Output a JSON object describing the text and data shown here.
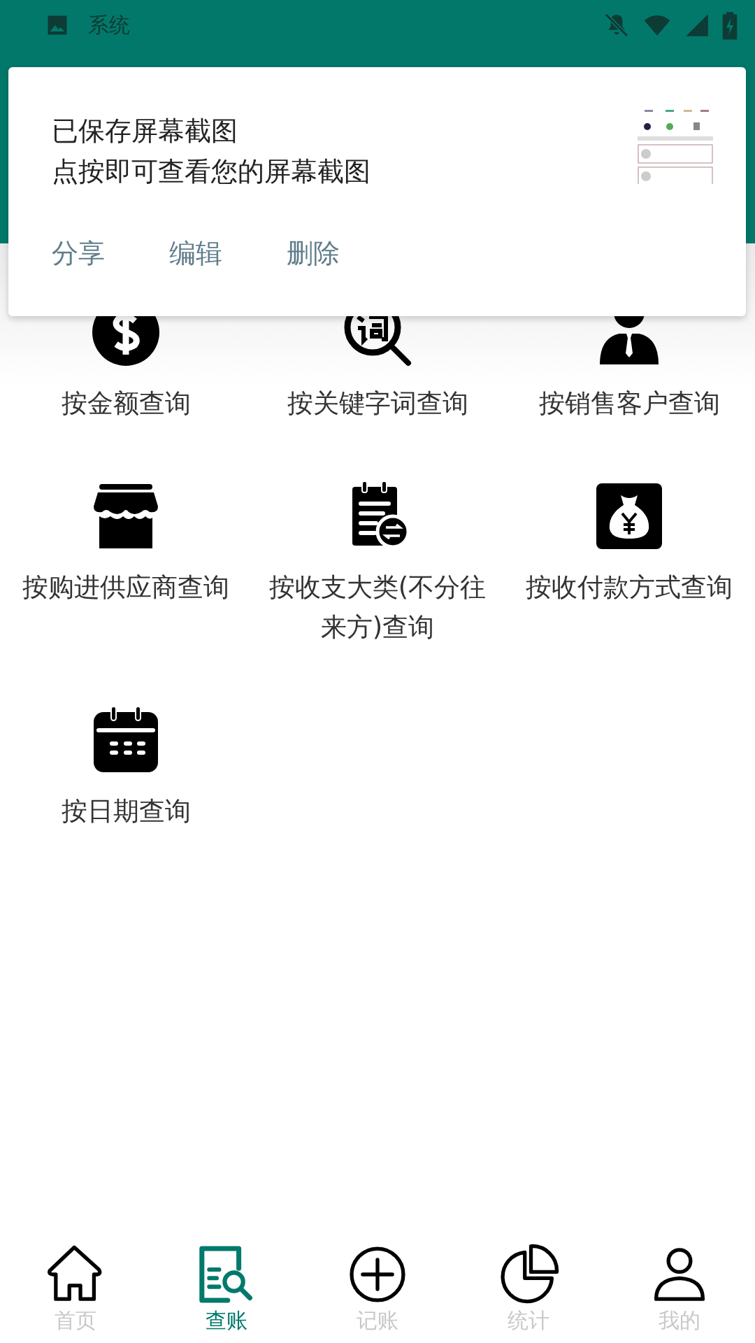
{
  "status_bar": {
    "app_label": "系统"
  },
  "notification": {
    "title": "已保存屏幕截图",
    "text": "点按即可查看您的屏幕截图",
    "actions": [
      "分享",
      "编辑",
      "删除"
    ]
  },
  "query_options": [
    {
      "kind": "amount",
      "label": "按金额查询"
    },
    {
      "kind": "keyword",
      "label": "按关键字词查询"
    },
    {
      "kind": "customer",
      "label": "按销售客户查询"
    },
    {
      "kind": "supplier",
      "label": "按购进供应商查询"
    },
    {
      "kind": "category",
      "label": "按收支大类(不分往来方)查询"
    },
    {
      "kind": "payment",
      "label": "按收付款方式查询"
    },
    {
      "kind": "date",
      "label": "按日期查询"
    }
  ],
  "bottom_nav": [
    {
      "kind": "home",
      "label": "首页",
      "selected": false
    },
    {
      "kind": "ledger",
      "label": "查账",
      "selected": true
    },
    {
      "kind": "add",
      "label": "记账",
      "selected": false
    },
    {
      "kind": "stats",
      "label": "统计",
      "selected": false
    },
    {
      "kind": "profile",
      "label": "我的",
      "selected": false
    }
  ]
}
